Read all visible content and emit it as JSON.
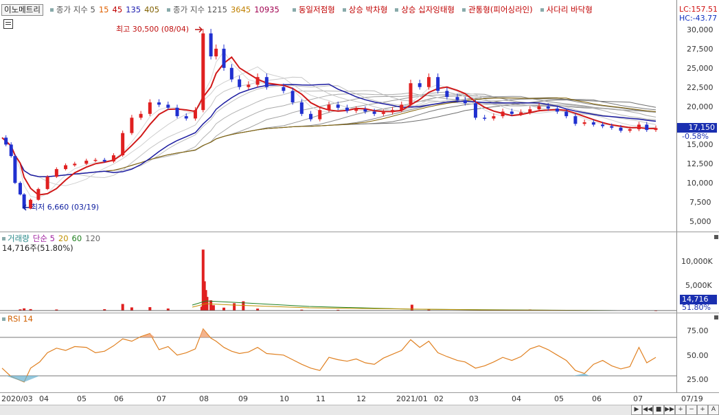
{
  "legend": {
    "stock_name": "이노메트리",
    "ma_short_label": "종가 지수 5",
    "ma_short_periods": [
      "15",
      "45",
      "135",
      "405"
    ],
    "ma_long_label": "종가 지수 1215",
    "ma_long_periods": [
      "3645",
      "10935"
    ],
    "patterns": [
      "동일저점형",
      "상승 박차형",
      "상승 십자잉태형",
      "관통형(피어싱라인)",
      "사다리 바닥형"
    ]
  },
  "price_pane": {
    "lc_label": "LC:157.51",
    "hc_label": "HC:-43.77",
    "y_ticks": [
      "30,000",
      "27,500",
      "25,000",
      "22,500",
      "20,000",
      "15,000",
      "12,500",
      "10,000",
      "7,500",
      "5,000"
    ],
    "current_price_tag": "17,150",
    "change_tag": "-0.58%",
    "high_annotation": "최고 30,500 (08/04)",
    "low_annotation": "최저 6,660 (03/19)"
  },
  "volume_pane": {
    "legend_title": "거래량",
    "legend_ma_label": "단순 5",
    "legend_periods": [
      "20",
      "60",
      "120"
    ],
    "value_label": "14,716주(51.80%)",
    "y_ticks": [
      "10,000K",
      "5,000K"
    ],
    "current_tag": "14,716",
    "pct_tag": "51.80%"
  },
  "rsi_pane": {
    "legend_label": "RSI 14",
    "y_ticks": [
      "75.00",
      "50.00",
      "25.00"
    ]
  },
  "x_axis": {
    "labels": [
      "2020/03",
      "04",
      "05",
      "06",
      "07",
      "08",
      "09",
      "10",
      "11",
      "12",
      "2021/01",
      "02",
      "03",
      "04",
      "05",
      "06",
      "07"
    ],
    "right_label": "07/19"
  },
  "nav": {
    "buttons": [
      "▶",
      "◀◀",
      "■",
      "▶▶",
      "+",
      "−",
      "+",
      "A"
    ]
  },
  "colors": {
    "up": "#e02020",
    "down": "#2030d0",
    "ma_red": "#d01818",
    "ma_blue": "#1a1aa0",
    "rsi": "#e08020"
  },
  "chart_data": [
    {
      "type": "line",
      "title": "",
      "ylim": [
        4500,
        31000
      ],
      "series": [
        {
          "values": [
            {
              "x": "2020-03-02",
              "y": 15900
            },
            {
              "x": "2020-03-05",
              "y": 15000
            },
            {
              "x": "2020-03-09",
              "y": 13500
            },
            {
              "x": "2020-03-12",
              "y": 10000
            },
            {
              "x": "2020-03-16",
              "y": 8500
            },
            {
              "x": "2020-03-19",
              "y": 6660
            },
            {
              "x": "2020-03-24",
              "y": 7800
            },
            {
              "x": "2020-03-30",
              "y": 9200
            },
            {
              "x": "2020-04-06",
              "y": 10800
            },
            {
              "x": "2020-04-13",
              "y": 11800
            },
            {
              "x": "2020-04-20",
              "y": 12300
            },
            {
              "x": "2020-04-27",
              "y": 12500
            },
            {
              "x": "2020-05-06",
              "y": 12900
            },
            {
              "x": "2020-05-13",
              "y": 13000
            },
            {
              "x": "2020-05-20",
              "y": 12800
            },
            {
              "x": "2020-05-27",
              "y": 13600
            },
            {
              "x": "2020-06-03",
              "y": 16500
            },
            {
              "x": "2020-06-10",
              "y": 18500
            },
            {
              "x": "2020-06-17",
              "y": 19000
            },
            {
              "x": "2020-06-24",
              "y": 20500
            },
            {
              "x": "2020-07-01",
              "y": 20200
            },
            {
              "x": "2020-07-08",
              "y": 19800
            },
            {
              "x": "2020-07-15",
              "y": 18700
            },
            {
              "x": "2020-07-22",
              "y": 18400
            },
            {
              "x": "2020-07-29",
              "y": 19500
            },
            {
              "x": "2020-08-04",
              "y": 29500
            },
            {
              "x": "2020-08-10",
              "y": 26500
            },
            {
              "x": "2020-08-14",
              "y": 27500
            },
            {
              "x": "2020-08-20",
              "y": 25000
            },
            {
              "x": "2020-08-26",
              "y": 23500
            },
            {
              "x": "2020-09-01",
              "y": 22500
            },
            {
              "x": "2020-09-08",
              "y": 22800
            },
            {
              "x": "2020-09-15",
              "y": 23800
            },
            {
              "x": "2020-09-22",
              "y": 22500
            },
            {
              "x": "2020-10-05",
              "y": 22000
            },
            {
              "x": "2020-10-12",
              "y": 20500
            },
            {
              "x": "2020-10-19",
              "y": 19000
            },
            {
              "x": "2020-10-26",
              "y": 18300
            },
            {
              "x": "2020-11-02",
              "y": 19500
            },
            {
              "x": "2020-11-09",
              "y": 20200
            },
            {
              "x": "2020-11-16",
              "y": 19800
            },
            {
              "x": "2020-11-23",
              "y": 19400
            },
            {
              "x": "2020-11-30",
              "y": 19600
            },
            {
              "x": "2020-12-07",
              "y": 19300
            },
            {
              "x": "2020-12-14",
              "y": 19000
            },
            {
              "x": "2020-12-21",
              "y": 19200
            },
            {
              "x": "2020-12-28",
              "y": 19500
            },
            {
              "x": "2021-01-04",
              "y": 20200
            },
            {
              "x": "2021-01-11",
              "y": 23000
            },
            {
              "x": "2021-01-18",
              "y": 22500
            },
            {
              "x": "2021-01-25",
              "y": 23800
            },
            {
              "x": "2021-02-01",
              "y": 22000
            },
            {
              "x": "2021-02-08",
              "y": 21200
            },
            {
              "x": "2021-02-16",
              "y": 20800
            },
            {
              "x": "2021-02-22",
              "y": 20400
            },
            {
              "x": "2021-03-02",
              "y": 18500
            },
            {
              "x": "2021-03-09",
              "y": 18400
            },
            {
              "x": "2021-03-16",
              "y": 18700
            },
            {
              "x": "2021-03-23",
              "y": 19300
            },
            {
              "x": "2021-03-30",
              "y": 19000
            },
            {
              "x": "2021-04-06",
              "y": 19200
            },
            {
              "x": "2021-04-13",
              "y": 19600
            },
            {
              "x": "2021-04-20",
              "y": 20000
            },
            {
              "x": "2021-04-27",
              "y": 19700
            },
            {
              "x": "2021-05-04",
              "y": 19300
            },
            {
              "x": "2021-05-11",
              "y": 18700
            },
            {
              "x": "2021-05-18",
              "y": 17700
            },
            {
              "x": "2021-05-25",
              "y": 17900
            },
            {
              "x": "2021-06-01",
              "y": 17600
            },
            {
              "x": "2021-06-08",
              "y": 17400
            },
            {
              "x": "2021-06-15",
              "y": 17200
            },
            {
              "x": "2021-06-22",
              "y": 16800
            },
            {
              "x": "2021-06-29",
              "y": 17000
            },
            {
              "x": "2021-07-06",
              "y": 17600
            },
            {
              "x": "2021-07-12",
              "y": 16900
            },
            {
              "x": "2021-07-19",
              "y": 17150
            }
          ]
        }
      ]
    },
    {
      "type": "bar",
      "title": "",
      "ylim": [
        0,
        13000
      ],
      "series": [
        {
          "values": [
            {
              "x": "2020-03-16",
              "y": 250
            },
            {
              "x": "2020-03-19",
              "y": 450
            },
            {
              "x": "2020-03-24",
              "y": 300
            },
            {
              "x": "2020-04-13",
              "y": 220
            },
            {
              "x": "2020-05-20",
              "y": 280
            },
            {
              "x": "2020-06-03",
              "y": 1350
            },
            {
              "x": "2020-06-10",
              "y": 650
            },
            {
              "x": "2020-06-24",
              "y": 700
            },
            {
              "x": "2020-07-08",
              "y": 420
            },
            {
              "x": "2020-08-03",
              "y": 800
            },
            {
              "x": "2020-08-04",
              "y": 12500
            },
            {
              "x": "2020-08-05",
              "y": 6000
            },
            {
              "x": "2020-08-06",
              "y": 4200
            },
            {
              "x": "2020-08-07",
              "y": 2800
            },
            {
              "x": "2020-08-10",
              "y": 2100
            },
            {
              "x": "2020-08-12",
              "y": 1100
            },
            {
              "x": "2020-08-20",
              "y": 600
            },
            {
              "x": "2020-08-28",
              "y": 1500
            },
            {
              "x": "2020-09-04",
              "y": 1900
            },
            {
              "x": "2020-09-15",
              "y": 400
            },
            {
              "x": "2020-10-19",
              "y": 180
            },
            {
              "x": "2020-11-16",
              "y": 160
            },
            {
              "x": "2021-01-12",
              "y": 1200
            },
            {
              "x": "2021-01-25",
              "y": 320
            },
            {
              "x": "2021-04-13",
              "y": 220
            },
            {
              "x": "2021-07-19",
              "y": 14.716
            }
          ]
        }
      ]
    },
    {
      "type": "line",
      "title": "",
      "ylim": [
        10,
        95
      ],
      "series": [
        {
          "values": [
            {
              "x": "2020-03-02",
              "y": 35
            },
            {
              "x": "2020-03-09",
              "y": 24
            },
            {
              "x": "2020-03-19",
              "y": 17
            },
            {
              "x": "2020-03-24",
              "y": 35
            },
            {
              "x": "2020-03-31",
              "y": 43
            },
            {
              "x": "2020-04-06",
              "y": 55
            },
            {
              "x": "2020-04-13",
              "y": 61
            },
            {
              "x": "2020-04-20",
              "y": 58
            },
            {
              "x": "2020-04-27",
              "y": 63
            },
            {
              "x": "2020-05-06",
              "y": 62
            },
            {
              "x": "2020-05-13",
              "y": 55
            },
            {
              "x": "2020-05-20",
              "y": 57
            },
            {
              "x": "2020-05-27",
              "y": 64
            },
            {
              "x": "2020-06-03",
              "y": 73
            },
            {
              "x": "2020-06-10",
              "y": 70
            },
            {
              "x": "2020-06-17",
              "y": 76
            },
            {
              "x": "2020-06-24",
              "y": 80
            },
            {
              "x": "2020-07-01",
              "y": 59
            },
            {
              "x": "2020-07-08",
              "y": 63
            },
            {
              "x": "2020-07-15",
              "y": 52
            },
            {
              "x": "2020-07-22",
              "y": 55
            },
            {
              "x": "2020-07-29",
              "y": 60
            },
            {
              "x": "2020-08-04",
              "y": 86
            },
            {
              "x": "2020-08-10",
              "y": 74
            },
            {
              "x": "2020-08-14",
              "y": 70
            },
            {
              "x": "2020-08-20",
              "y": 62
            },
            {
              "x": "2020-08-26",
              "y": 57
            },
            {
              "x": "2020-09-01",
              "y": 54
            },
            {
              "x": "2020-09-08",
              "y": 56
            },
            {
              "x": "2020-09-15",
              "y": 62
            },
            {
              "x": "2020-09-22",
              "y": 54
            },
            {
              "x": "2020-10-05",
              "y": 52
            },
            {
              "x": "2020-10-12",
              "y": 46
            },
            {
              "x": "2020-10-19",
              "y": 40
            },
            {
              "x": "2020-10-26",
              "y": 35
            },
            {
              "x": "2020-11-02",
              "y": 32
            },
            {
              "x": "2020-11-09",
              "y": 49
            },
            {
              "x": "2020-11-16",
              "y": 46
            },
            {
              "x": "2020-11-23",
              "y": 44
            },
            {
              "x": "2020-11-30",
              "y": 47
            },
            {
              "x": "2020-12-07",
              "y": 42
            },
            {
              "x": "2020-12-14",
              "y": 40
            },
            {
              "x": "2020-12-21",
              "y": 48
            },
            {
              "x": "2020-12-28",
              "y": 53
            },
            {
              "x": "2021-01-04",
              "y": 58
            },
            {
              "x": "2021-01-11",
              "y": 72
            },
            {
              "x": "2021-01-18",
              "y": 62
            },
            {
              "x": "2021-01-25",
              "y": 70
            },
            {
              "x": "2021-02-01",
              "y": 55
            },
            {
              "x": "2021-02-08",
              "y": 50
            },
            {
              "x": "2021-02-16",
              "y": 45
            },
            {
              "x": "2021-02-22",
              "y": 43
            },
            {
              "x": "2021-03-02",
              "y": 35
            },
            {
              "x": "2021-03-09",
              "y": 38
            },
            {
              "x": "2021-03-16",
              "y": 43
            },
            {
              "x": "2021-03-23",
              "y": 49
            },
            {
              "x": "2021-03-30",
              "y": 45
            },
            {
              "x": "2021-04-06",
              "y": 50
            },
            {
              "x": "2021-04-13",
              "y": 60
            },
            {
              "x": "2021-04-20",
              "y": 64
            },
            {
              "x": "2021-04-27",
              "y": 59
            },
            {
              "x": "2021-05-04",
              "y": 52
            },
            {
              "x": "2021-05-11",
              "y": 45
            },
            {
              "x": "2021-05-18",
              "y": 32
            },
            {
              "x": "2021-05-25",
              "y": 28
            },
            {
              "x": "2021-06-01",
              "y": 40
            },
            {
              "x": "2021-06-08",
              "y": 45
            },
            {
              "x": "2021-06-15",
              "y": 38
            },
            {
              "x": "2021-06-22",
              "y": 34
            },
            {
              "x": "2021-06-29",
              "y": 37
            },
            {
              "x": "2021-07-06",
              "y": 62
            },
            {
              "x": "2021-07-12",
              "y": 42
            },
            {
              "x": "2021-07-19",
              "y": 49
            }
          ]
        }
      ]
    }
  ]
}
